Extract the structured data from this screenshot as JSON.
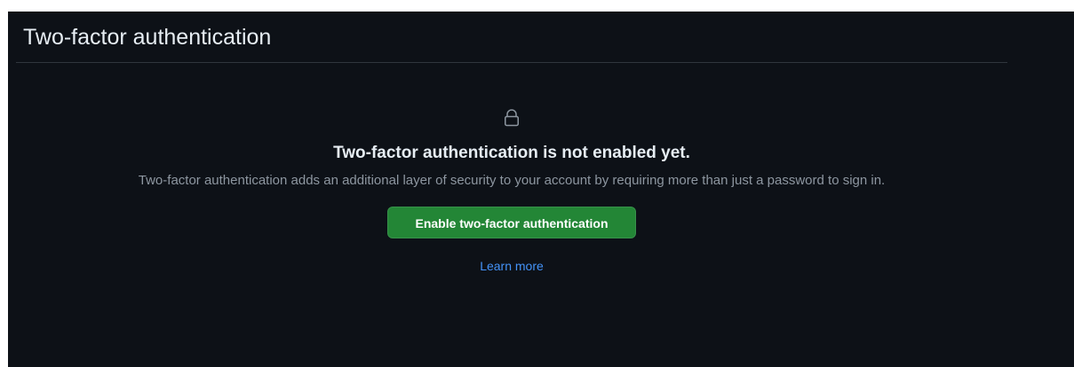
{
  "header": {
    "title": "Two-factor authentication"
  },
  "empty_state": {
    "icon": "lock-icon",
    "title": "Two-factor authentication is not enabled yet.",
    "description": "Two-factor authentication adds an additional layer of security to your account by requiring more than just a password to sign in.",
    "enable_button_label": "Enable two-factor authentication",
    "learn_more_label": "Learn more"
  },
  "colors": {
    "background": "#0d1117",
    "border": "#30363d",
    "text_primary": "#e6edf3",
    "text_muted": "#8d96a0",
    "button_green": "#238636",
    "link_blue": "#4493f8"
  }
}
